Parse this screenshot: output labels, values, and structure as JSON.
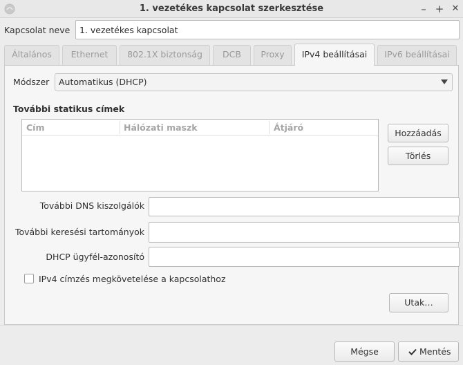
{
  "window": {
    "title": "1. vezetékes kapcsolat szerkesztése",
    "minimize": "–",
    "maximize": "+",
    "close": "✕"
  },
  "connection_name": {
    "label": "Kapcsolat neve",
    "value": "1. vezetékes kapcsolat"
  },
  "tabs": [
    {
      "label": "Általános",
      "active": false
    },
    {
      "label": "Ethernet",
      "active": false
    },
    {
      "label": "802.1X biztonság",
      "active": false
    },
    {
      "label": "DCB",
      "active": false
    },
    {
      "label": "Proxy",
      "active": false
    },
    {
      "label": "IPv4 beállításai",
      "active": true
    },
    {
      "label": "IPv6 beállításai",
      "active": false
    }
  ],
  "ipv4": {
    "method_label": "Módszer",
    "method_value": "Automatikus (DHCP)",
    "static_heading": "További statikus címek",
    "columns": [
      "Cím",
      "Hálózati maszk",
      "Átjáró"
    ],
    "add_button": "Hozzáadás",
    "delete_button": "Törlés",
    "dns_label": "További DNS kiszolgálók",
    "dns_value": "",
    "search_label": "További keresési tartományok",
    "search_value": "",
    "dhcp_label": "DHCP ügyfél-azonosító",
    "dhcp_value": "",
    "require_ipv4_label": "IPv4 címzés megkövetelése a kapcsolathoz",
    "require_ipv4_checked": false,
    "routes_button": "Utak…"
  },
  "footer": {
    "cancel_button": "Mégse",
    "save_button": "Mentés",
    "save_icon": "checkmark-icon"
  }
}
